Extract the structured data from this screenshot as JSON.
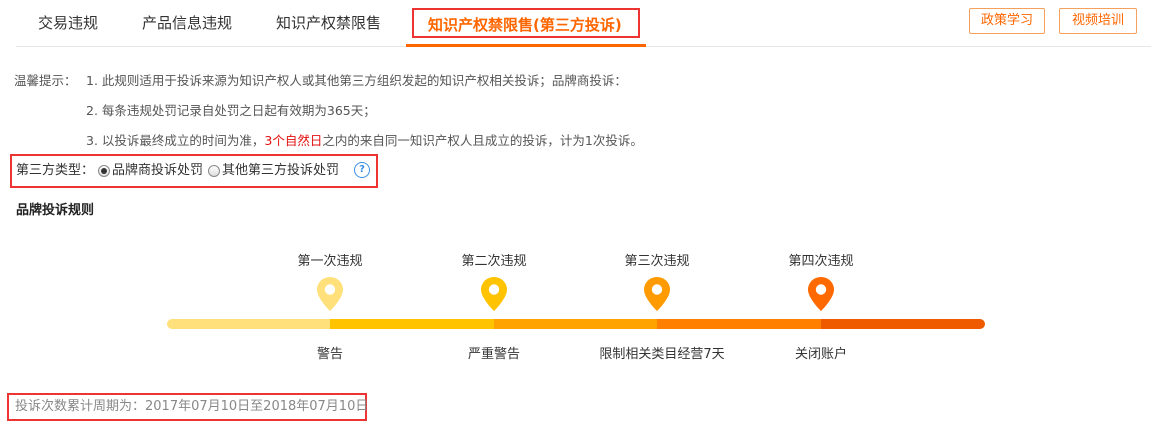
{
  "tabs": [
    {
      "label": "交易违规"
    },
    {
      "label": "产品信息违规"
    },
    {
      "label": "知识产权禁限售"
    },
    {
      "label": "知识产权禁限售(第三方投诉)"
    }
  ],
  "buttons": {
    "policy": "政策学习",
    "video": "视频培训"
  },
  "tips": {
    "label": "温馨提示：",
    "line1": "1. 此规则适用于投诉来源为知识产权人或其他第三方组织发起的知识产权相关投诉；品牌商投诉：",
    "line2": "2. 每条违规处罚记录自处罚之日起有效期为365天；",
    "line3_pre": "3. 以投诉最终成立的时间为准，",
    "line3_hl": "3个自然日",
    "line3_post": "之内的来自同一知识产权人且成立的投诉，计为1次投诉。"
  },
  "third_party": {
    "label": "第三方类型：",
    "options": [
      {
        "label": "品牌商投诉处罚",
        "selected": true
      },
      {
        "label": "其他第三方投诉处罚",
        "selected": false
      }
    ],
    "help": "?"
  },
  "section_title": "品牌投诉规则",
  "timeline": {
    "steps": [
      {
        "title": "第一次违规",
        "label": "警告",
        "color": "#ffe07a"
      },
      {
        "title": "第二次违规",
        "label": "严重警告",
        "color": "#ffc300"
      },
      {
        "title": "第三次违规",
        "label": "限制相关类目经营7天",
        "color": "#ff9a00"
      },
      {
        "title": "第四次违规",
        "label": "关闭账户",
        "color": "#ff6a00"
      }
    ],
    "bar_colors": [
      "#ffe07a",
      "#ffc300",
      "#ffa300",
      "#ff7f00",
      "#ef5a00"
    ]
  },
  "period": "投诉次数累计周期为：2017年07月10日至2018年07月10日"
}
